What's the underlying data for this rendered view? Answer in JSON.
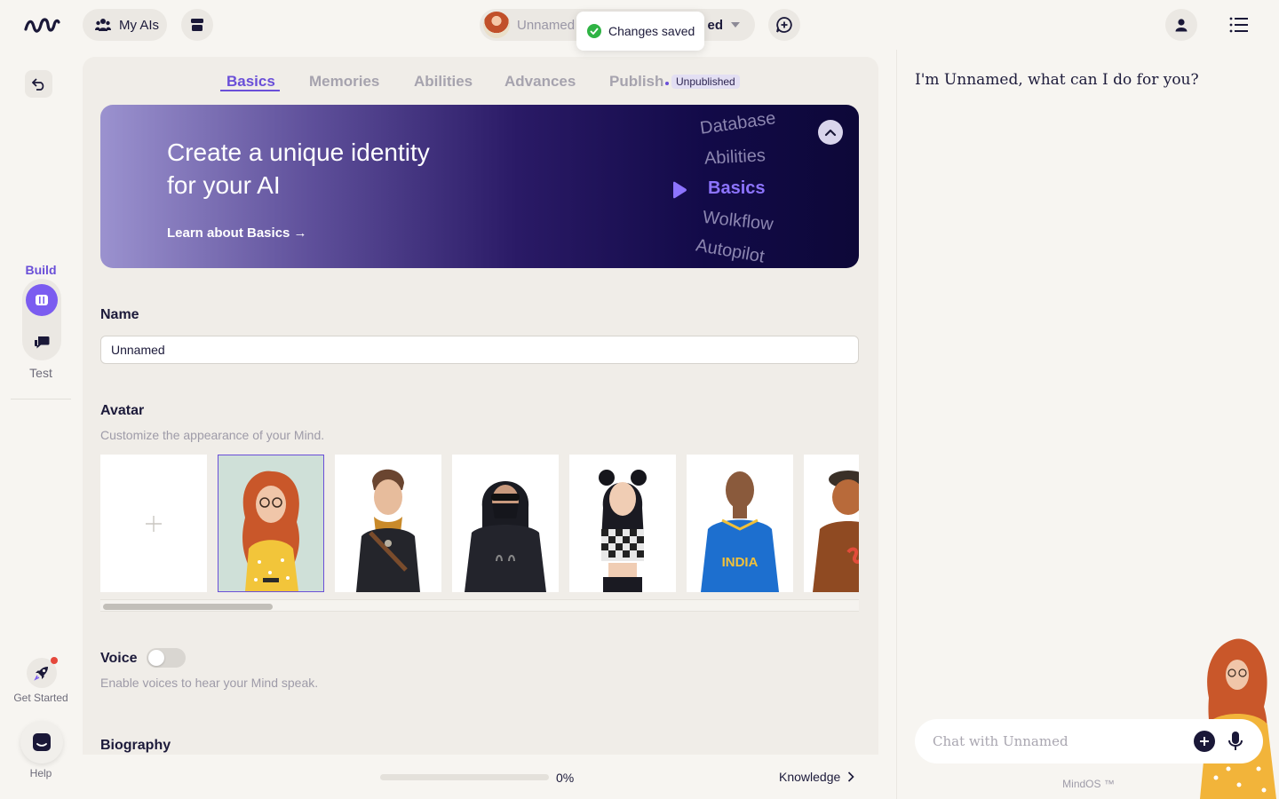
{
  "topbar": {
    "my_ais_label": "My AIs",
    "current_ai_name": "Unnamed",
    "current_ai_tail": "ed",
    "toast_text": "Changes saved"
  },
  "rail": {
    "build_label": "Build",
    "test_label": "Test",
    "get_started_label": "Get Started",
    "help_label": "Help"
  },
  "tabs": [
    {
      "label": "Basics",
      "active": true
    },
    {
      "label": "Memories",
      "active": false
    },
    {
      "label": "Abilities",
      "active": false
    },
    {
      "label": "Advances",
      "active": false
    },
    {
      "label": "Publish",
      "active": false
    }
  ],
  "publish_badge": "Unpublished",
  "hero": {
    "title_line1": "Create a unique identity",
    "title_line2": "for your AI",
    "link_text": "Learn about Basics →",
    "wheel": [
      "Database",
      "Abilities",
      "Basics",
      "Wolkflow",
      "Autopilot"
    ],
    "wheel_current": "Basics"
  },
  "name_section": {
    "title": "Name",
    "value": "Unnamed"
  },
  "avatar_section": {
    "title": "Avatar",
    "subtitle": "Customize the appearance of your Mind.",
    "cards": [
      {
        "name": "add-avatar",
        "selected": false
      },
      {
        "name": "red-hair-glasses-woman",
        "selected": true
      },
      {
        "name": "young-man-scarf",
        "selected": false
      },
      {
        "name": "masked-hooded-figure",
        "selected": false
      },
      {
        "name": "checkered-top-girl",
        "selected": false
      },
      {
        "name": "india-jersey-man",
        "selected": false
      },
      {
        "name": "gingerbread-character",
        "selected": false
      }
    ],
    "jersey_text": "INDIA"
  },
  "voice_section": {
    "title": "Voice",
    "subtitle": "Enable voices to hear your Mind speak.",
    "enabled": false
  },
  "biography_section": {
    "title": "Biography"
  },
  "footer": {
    "progress": 0,
    "progress_label": "0%",
    "next_label": "Knowledge"
  },
  "chat": {
    "greeting": "I'm Unnamed, what can I do for you?",
    "input_placeholder": "Chat with Unnamed",
    "brand": "MindOS ™"
  },
  "colors": {
    "accent": "#6a4fd8",
    "background": "#f7f5f1",
    "panel": "#f0ede8",
    "toast_success": "#2fb344"
  }
}
